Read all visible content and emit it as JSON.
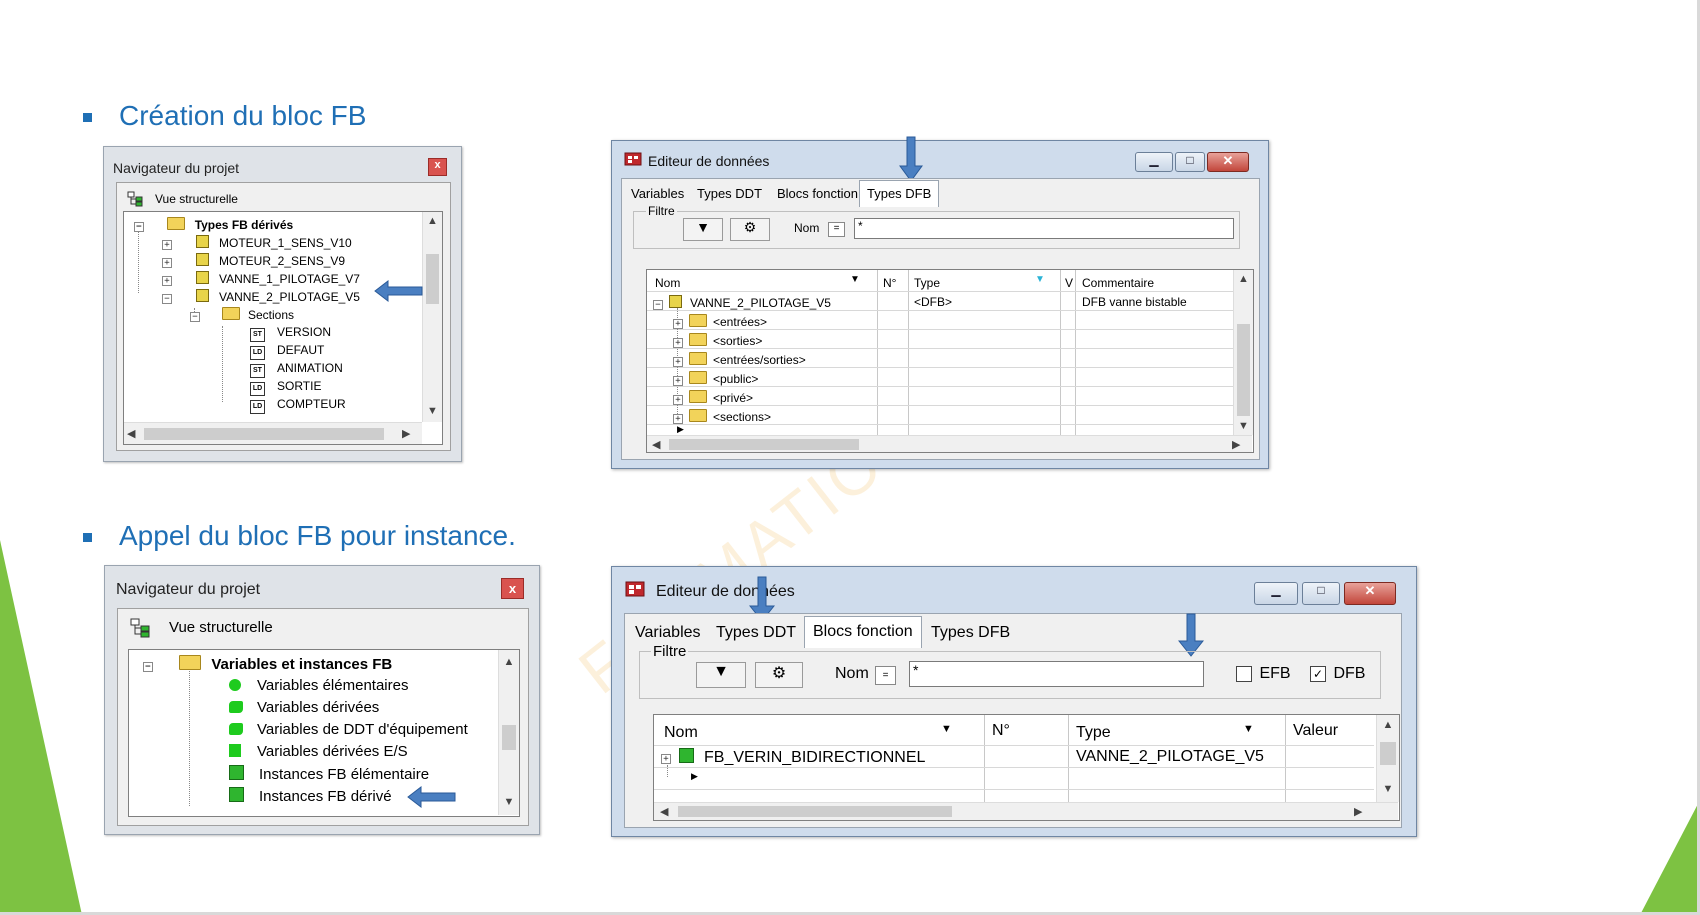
{
  "slide": {
    "heading1": "Création du bloc FB",
    "heading2": "Appel du bloc FB pour instance.",
    "watermark": "FORMATION"
  },
  "colors": {
    "heading": "#1f6fb5",
    "accent_green": "#7dc242",
    "arrow": "#4a7fc1"
  },
  "nav1": {
    "title": "Navigateur du projet",
    "close": "x",
    "view_label": "Vue structurelle",
    "tree": {
      "root": "Types FB dérivés",
      "items": [
        "MOTEUR_1_SENS_V10",
        "MOTEUR_2_SENS_V9",
        "VANNE_1_PILOTAGE_V7",
        "VANNE_2_PILOTAGE_V5"
      ],
      "sections_label": "Sections",
      "sections": [
        {
          "badge": "ST",
          "name": "VERSION"
        },
        {
          "badge": "LD",
          "name": "DEFAUT"
        },
        {
          "badge": "ST",
          "name": "ANIMATION"
        },
        {
          "badge": "LD",
          "name": "SORTIE"
        },
        {
          "badge": "LD",
          "name": "COMPTEUR"
        }
      ]
    }
  },
  "editor1": {
    "title": "Editeur de données",
    "tabs": [
      "Variables",
      "Types DDT",
      "Blocs fonction",
      "Types DFB"
    ],
    "active_tab": "Types DFB",
    "filter_label": "Filtre",
    "name_label": "Nom",
    "eq": "=",
    "filter_value": "*",
    "columns": [
      "Nom",
      "N°",
      "Type",
      "V",
      "Commentaire"
    ],
    "row": {
      "name": "VANNE_2_PILOTAGE_V5",
      "type": "<DFB>",
      "comment": "DFB vanne bistable"
    },
    "children": [
      "<entrées>",
      "<sorties>",
      "<entrées/sorties>",
      "<public>",
      "<privé>",
      "<sections>"
    ]
  },
  "nav2": {
    "title": "Navigateur du projet",
    "close": "x",
    "view_label": "Vue structurelle",
    "tree": {
      "root": "Variables et instances FB",
      "items": [
        "Variables élémentaires",
        "Variables dérivées",
        "Variables de DDT d'équipement",
        "Variables dérivées E/S",
        "Instances FB élémentaire",
        "Instances FB dérivé"
      ]
    }
  },
  "editor2": {
    "title": "Editeur de données",
    "tabs": [
      "Variables",
      "Types DDT",
      "Blocs fonction",
      "Types DFB"
    ],
    "active_tab": "Blocs fonction",
    "filter_label": "Filtre",
    "name_label": "Nom",
    "eq": "=",
    "filter_value": "*",
    "efb_label": "EFB",
    "dfb_label": "DFB",
    "efb_checked": false,
    "dfb_checked": true,
    "columns": [
      "Nom",
      "N°",
      "Type",
      "Valeur"
    ],
    "row": {
      "name": "FB_VERIN_BIDIRECTIONNEL",
      "type": "VANNE_2_PILOTAGE_V5"
    }
  }
}
